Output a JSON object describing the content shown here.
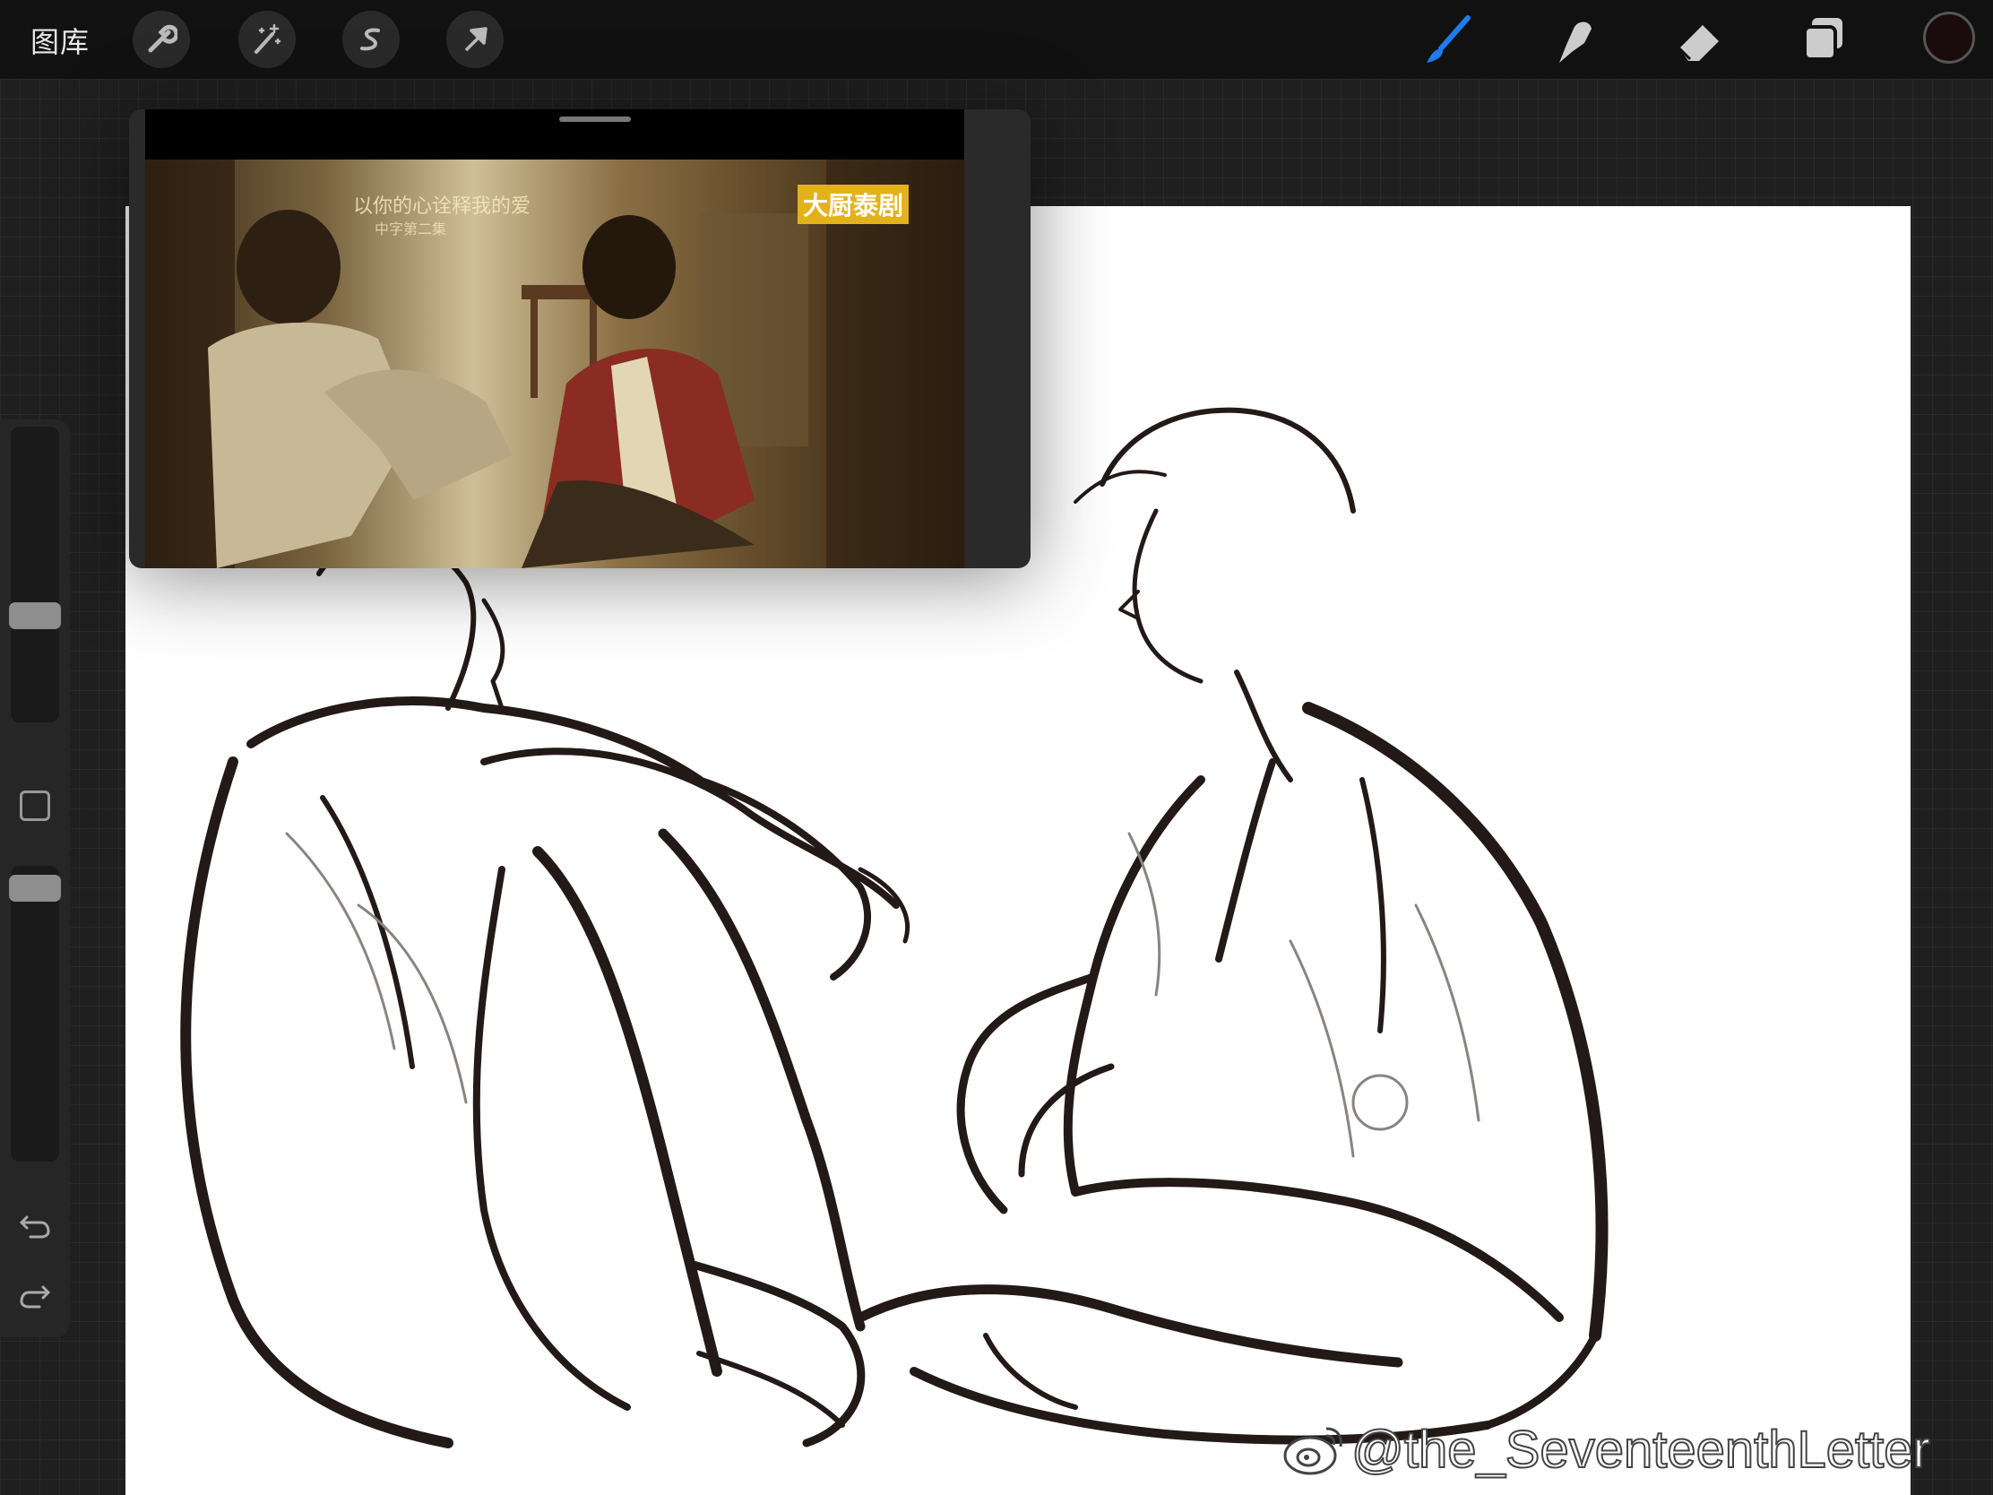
{
  "toolbar": {
    "gallery_label": "图库",
    "left_tools": [
      {
        "name": "actions",
        "icon": "wrench-icon"
      },
      {
        "name": "adjustments",
        "icon": "magic-wand-icon"
      },
      {
        "name": "selection",
        "icon": "selection-s-icon"
      },
      {
        "name": "transform",
        "icon": "arrow-cursor-icon"
      }
    ],
    "right_tools": [
      {
        "name": "brush",
        "icon": "brush-icon",
        "active": true,
        "color": "#1e7cf2"
      },
      {
        "name": "smudge",
        "icon": "smudge-finger-icon"
      },
      {
        "name": "eraser",
        "icon": "eraser-icon"
      },
      {
        "name": "layers",
        "icon": "layers-icon"
      }
    ],
    "current_color": "#1a0c0c"
  },
  "reference": {
    "caption_line1": "以你的心诠释我的爱",
    "caption_line2": "中字第二集",
    "badge": "大厨泰剧",
    "badge_color": "#e3b21b"
  },
  "sidebar": {
    "brush_size_level": 0.63,
    "opacity_level": 0.97,
    "undo_icon": "undo-icon",
    "redo_icon": "redo-icon"
  },
  "watermark": {
    "text": "@the_SeventeenthLetter",
    "icon": "weibo-icon"
  }
}
